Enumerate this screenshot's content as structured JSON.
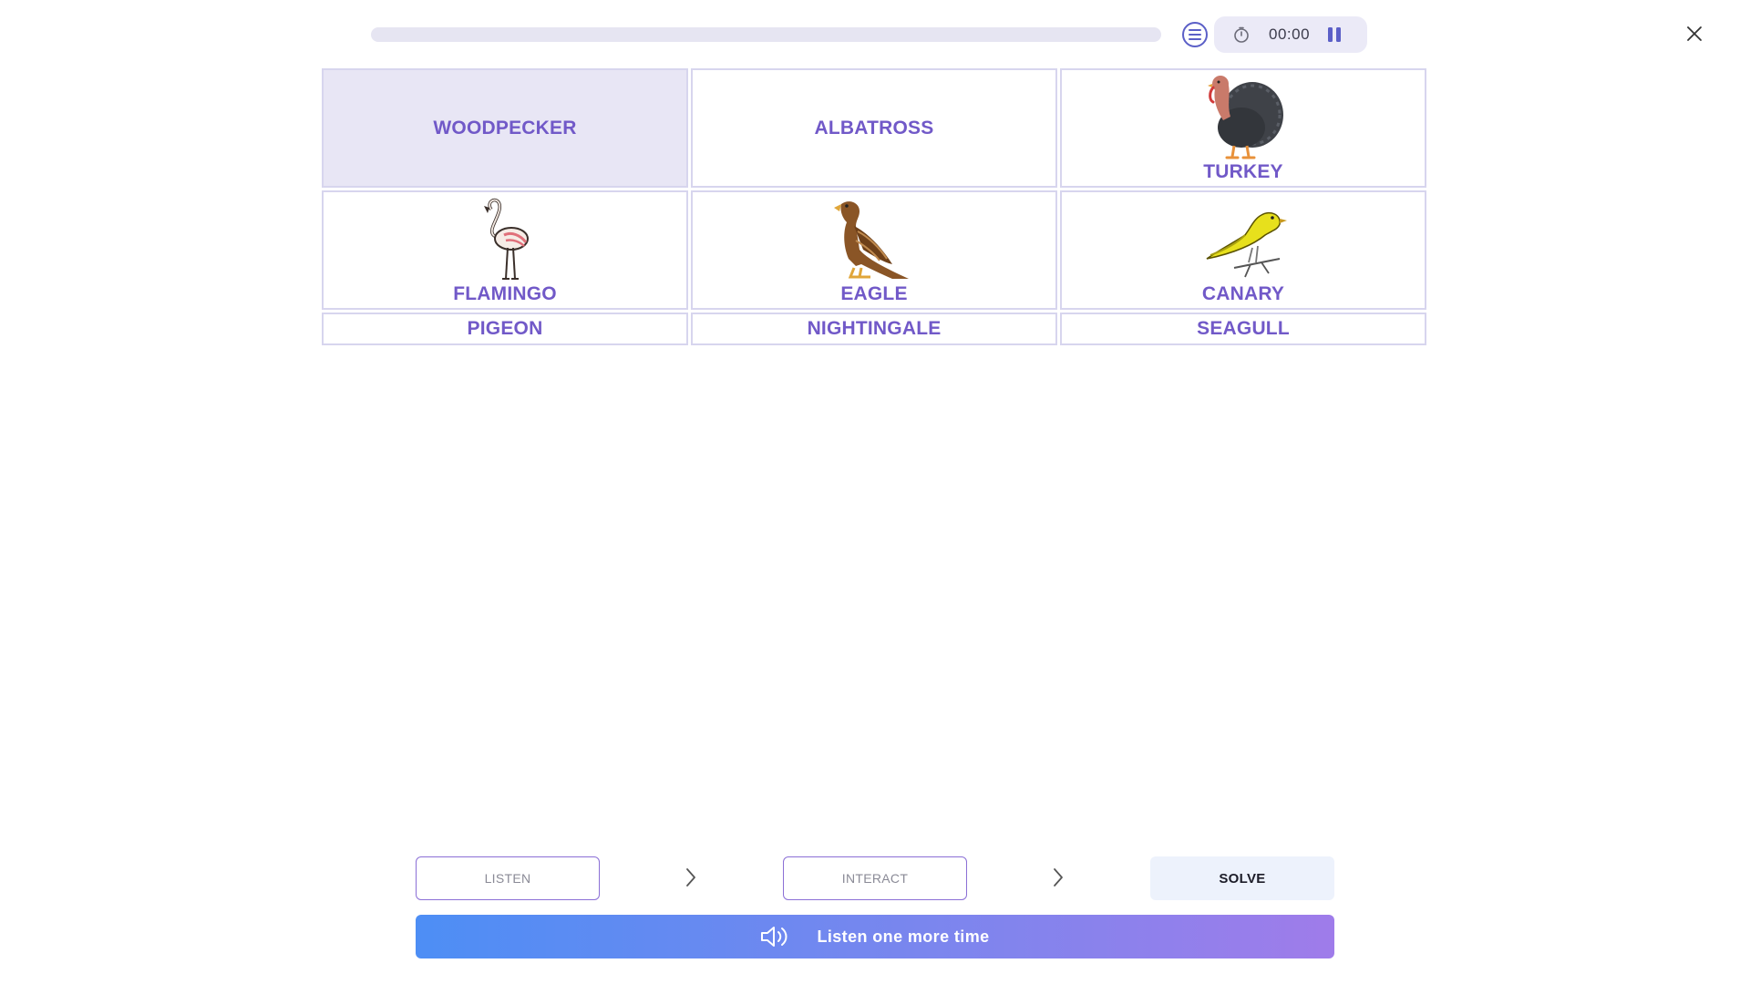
{
  "progress": {
    "fraction": 0.0
  },
  "timer": {
    "time": "00:00"
  },
  "tiles": [
    {
      "label": "WOODPECKER",
      "image": "none",
      "selected": true
    },
    {
      "label": "ALBATROSS",
      "image": "none",
      "selected": false
    },
    {
      "label": "TURKEY",
      "image": "turkey-illustration",
      "selected": false
    },
    {
      "label": "FLAMINGO",
      "image": "flamingo-illustration",
      "selected": false
    },
    {
      "label": "EAGLE",
      "image": "eagle-illustration",
      "selected": false
    },
    {
      "label": "CANARY",
      "image": "canary-illustration",
      "selected": false
    },
    {
      "label": "PIGEON",
      "image": "none",
      "selected": false
    },
    {
      "label": "NIGHTINGALE",
      "image": "none",
      "selected": false
    },
    {
      "label": "SEAGULL",
      "image": "none",
      "selected": false
    }
  ],
  "steps": {
    "listen": "LISTEN",
    "interact": "INTERACT",
    "solve": "SOLVE"
  },
  "listen_again": {
    "label": "Listen one more time"
  },
  "colors": {
    "accent": "#7159c8",
    "tile_border": "#d7d5ee",
    "selected_tile": "#e8e6f5",
    "gradient_start": "#4d8ef5",
    "gradient_end": "#9f7cea"
  }
}
